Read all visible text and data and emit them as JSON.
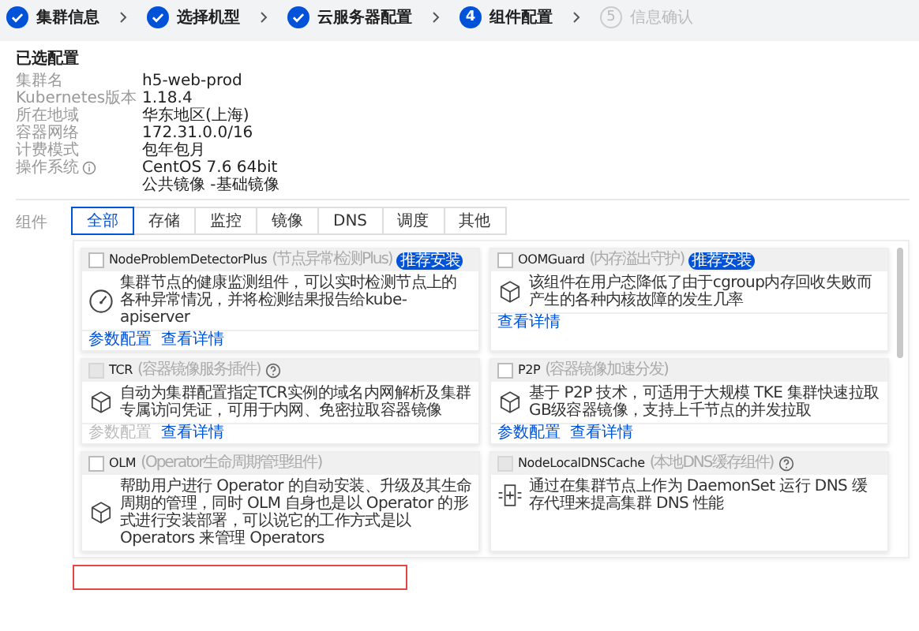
{
  "steps": [
    {
      "label": "集群信息",
      "done": true,
      "current": false
    },
    {
      "label": "选择机型",
      "done": true,
      "current": false
    },
    {
      "label": "云服务器配置",
      "done": true,
      "current": false
    },
    {
      "label": "组件配置",
      "done": false,
      "current": true,
      "number": "4"
    },
    {
      "label": "信息确认",
      "done": false,
      "current": false,
      "number": "5"
    }
  ],
  "selected_config": {
    "title": "已选配置",
    "rows": [
      {
        "label": "集群名",
        "values": [
          "h5-web-prod"
        ]
      },
      {
        "label": "Kubernetes版本",
        "values": [
          "1.18.4"
        ]
      },
      {
        "label": "所在地域",
        "values": [
          "华东地区(上海)"
        ]
      },
      {
        "label": "容器网络",
        "values": [
          "172.31.0.0/16"
        ]
      },
      {
        "label": "计费模式",
        "values": [
          "包年包月"
        ]
      },
      {
        "label": "操作系统",
        "info": true,
        "values": [
          "CentOS 7.6 64bit",
          "公共镜像 -基础镜像"
        ]
      }
    ]
  },
  "components": {
    "label": "组件",
    "tabs": [
      {
        "label": "全部",
        "selected": true
      },
      {
        "label": "存储",
        "selected": false
      },
      {
        "label": "监控",
        "selected": false
      },
      {
        "label": "镜像",
        "selected": false
      },
      {
        "label": "DNS",
        "selected": false
      },
      {
        "label": "调度",
        "selected": false
      },
      {
        "label": "其他",
        "selected": false
      }
    ],
    "cards": [
      {
        "name": "NodeProblemDetectorPlus",
        "subtitle": "(节点异常检测Plus)",
        "badge": "推荐安装",
        "kind": "gauge",
        "checked": false,
        "disabled": false,
        "help": false,
        "description": "集群节点的健康监测组件，可以实时检测节点上的各种异常情况，并将检测结果报告给kube-apiserver",
        "links": [
          {
            "label": "参数配置",
            "disabled": false
          },
          {
            "label": "查看详情",
            "disabled": false
          }
        ]
      },
      {
        "name": "OOMGuard",
        "subtitle": "(内存溢出守护)",
        "badge": "推荐安装",
        "kind": "cube",
        "checked": false,
        "disabled": false,
        "help": false,
        "description": "该组件在用户态降低了由于cgroup内存回收失败而产生的各种内核故障的发生几率",
        "links": [
          {
            "label": "查看详情",
            "disabled": false
          }
        ]
      },
      {
        "name": "TCR",
        "subtitle": "(容器镜像服务插件)",
        "kind": "cube",
        "checked": false,
        "disabled": true,
        "help": true,
        "description": "自动为集群配置指定TCR实例的域名内网解析及集群专属访问凭证，可用于内网、免密拉取容器镜像",
        "links": [
          {
            "label": "参数配置",
            "disabled": true
          },
          {
            "label": "查看详情",
            "disabled": false
          }
        ]
      },
      {
        "name": "P2P",
        "subtitle": "(容器镜像加速分发)",
        "kind": "cube",
        "checked": false,
        "disabled": false,
        "help": false,
        "description": "基于 P2P 技术，可适用于大规模 TKE 集群快速拉取GB级容器镜像，支持上千节点的并发拉取",
        "links": [
          {
            "label": "参数配置",
            "disabled": false
          },
          {
            "label": "查看详情",
            "disabled": false
          }
        ]
      },
      {
        "name": "OLM",
        "subtitle": "(Operator生命周期管理组件)",
        "kind": "cube",
        "checked": false,
        "disabled": false,
        "help": false,
        "description": "帮助用户进行 Operator 的自动安装、升级及其生命周期的管理，同时 OLM 自身也是以 Operator 的形式进行安装部署，可以说它的工作方式是以 Operators 来管理 Operators"
      },
      {
        "name": "NodeLocalDNSCache",
        "subtitle": "(本地DNS缓存组件)",
        "kind": "dns",
        "checked": false,
        "disabled": true,
        "help": true,
        "description": "通过在集群节点上作为 DaemonSet 运行 DNS 缓存代理来提高集群 DNS 性能"
      }
    ]
  },
  "bottom_field": {
    "invalid": true
  }
}
